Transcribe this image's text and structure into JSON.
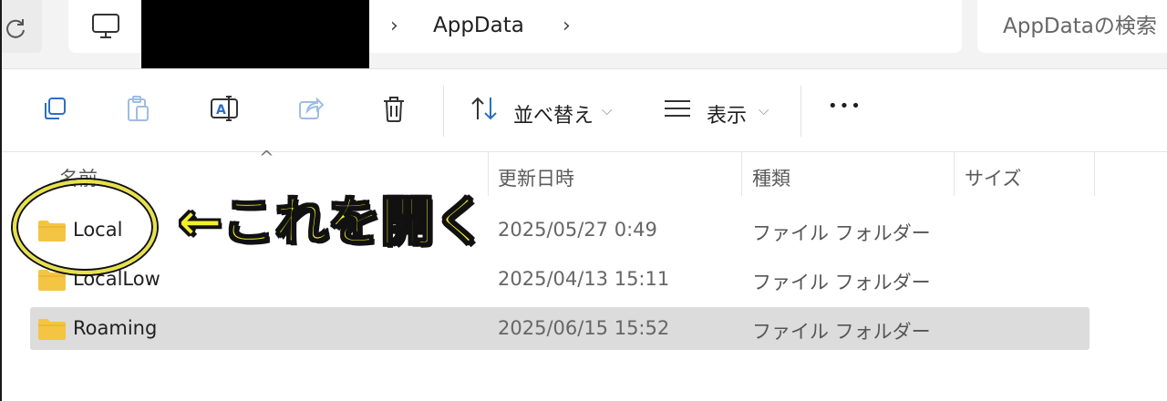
{
  "address_bar": {
    "crumbs": [
      "AppData"
    ],
    "search_placeholder": "AppDataの検索"
  },
  "toolbar": {
    "sort_label": "並べ替え",
    "view_label": "表示",
    "more_label": "•••"
  },
  "columns": {
    "name": "名前",
    "date": "更新日時",
    "type": "種類",
    "size": "サイズ"
  },
  "rows": [
    {
      "name": "Local",
      "date": "2025/05/27 0:49",
      "type": "ファイル フォルダー",
      "selected": false
    },
    {
      "name": "LocalLow",
      "date": "2025/04/13 15:11",
      "type": "ファイル フォルダー",
      "selected": false
    },
    {
      "name": "Roaming",
      "date": "2025/06/15 15:52",
      "type": "ファイル フォルダー",
      "selected": true
    }
  ],
  "annotation": {
    "text": "←これを開く",
    "color": "#f5ef2a"
  },
  "colors": {
    "folder": "#f4c542",
    "selected_row": "#dcdcdc"
  }
}
